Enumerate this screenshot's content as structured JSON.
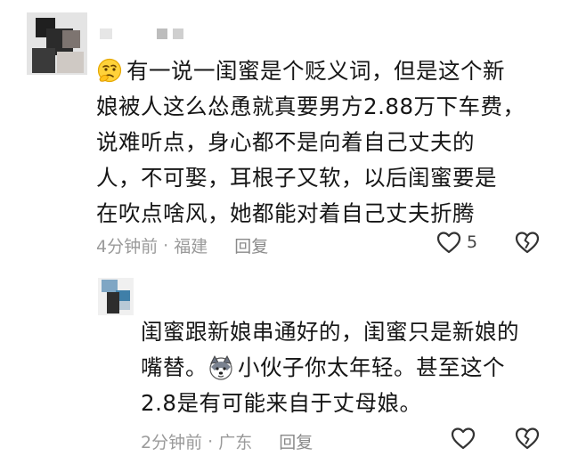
{
  "comments": [
    {
      "avatar_icon": "blurred-avatar",
      "username_blurred": true,
      "emoji": "thinking-face-emoji",
      "lines": [
        "有一说一闺蜜是个贬义词，但是这个新",
        "娘被人这么怂恿就真要男方2.88万下车费，",
        "说难听点，身心都不是向着自己丈夫的",
        "人，不可娶，耳根子又软，以后闺蜜要是",
        "在吹点啥风，她都能对着自己丈夫折腾"
      ],
      "time": "4分钟前",
      "location": "福建",
      "reply_label": "回复",
      "likes": "5"
    },
    {
      "avatar_icon": "blurred-avatar",
      "emoji": "husky-dog-emoji",
      "line1": "闺蜜跟新娘串通好的，闺蜜只是新娘的",
      "line2_before": "嘴替。",
      "line2_after": "小伙子你太年轻。甚至这个",
      "line3": "2.8是有可能来自于丈母娘。",
      "time": "2分钟前",
      "location": "广东",
      "reply_label": "回复"
    }
  ],
  "icons": {
    "like": "heart-outline-icon",
    "dislike": "broken-heart-icon"
  },
  "colors": {
    "text": "#161616",
    "meta": "#9a9a9a",
    "icon": "#333333"
  }
}
